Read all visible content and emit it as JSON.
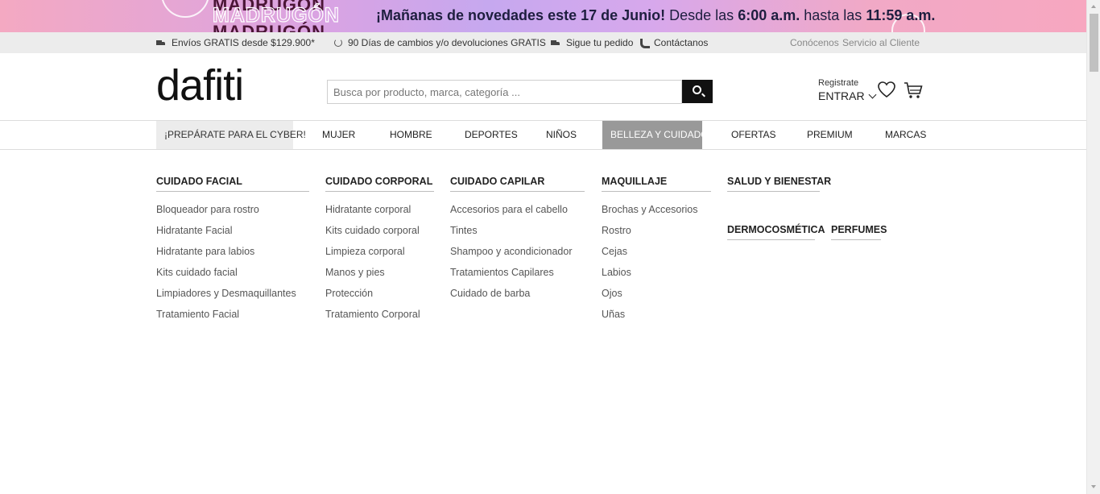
{
  "promo": {
    "brand_word": "MADRUGÓN",
    "headline_bold": "¡Mañanas de novedades este 17 de Junio!",
    "headline_rest_1": "Desde las",
    "time_start": "6:00 a.m.",
    "headline_rest_2": "hasta las",
    "time_end": "11:59 a.m."
  },
  "utility": {
    "shipping": "Envíos GRATIS desde $129.900*",
    "returns": "90 Días de cambios y/o devoluciones GRATIS",
    "tracking": "Sigue tu pedido",
    "contact": "Contáctanos",
    "about": "Conócenos",
    "customer_service": "Servicio al Cliente"
  },
  "header": {
    "logo": "dafiti",
    "search_placeholder": "Busca por producto, marca, categoría ...",
    "register": "Registrate",
    "login": "ENTRAR"
  },
  "nav": {
    "items": [
      "¡PREPÁRATE PARA EL CYBER!",
      "MUJER",
      "HOMBRE",
      "DEPORTES",
      "NIÑOS",
      "BELLEZA Y CUIDADO",
      "OFERTAS",
      "PREMIUM",
      "MARCAS"
    ],
    "active": "BELLEZA Y CUIDADO"
  },
  "menu": {
    "facial": {
      "heading": "CUIDADO FACIAL",
      "items": [
        "Bloqueador para rostro",
        "Hidratante Facial",
        "Hidratante para labios",
        "Kits cuidado facial",
        "Limpiadores y Desmaquillantes",
        "Tratamiento Facial"
      ]
    },
    "corporal": {
      "heading": "CUIDADO CORPORAL",
      "items": [
        "Hidratante corporal",
        "Kits cuidado corporal",
        "Limpieza corporal",
        "Manos y pies",
        "Protección",
        "Tratamiento Corporal"
      ]
    },
    "capilar": {
      "heading": "CUIDADO CAPILAR",
      "items": [
        "Accesorios para el cabello",
        "Tintes",
        "Shampoo y acondicionador",
        "Tratamientos Capilares",
        "Cuidado de barba"
      ]
    },
    "maquillaje": {
      "heading": "MAQUILLAJE",
      "items": [
        "Brochas y Accesorios",
        "Rostro",
        "Cejas",
        "Labios",
        "Ojos",
        "Uñas"
      ]
    },
    "salud": {
      "heading": "SALUD Y BIENESTAR"
    },
    "dermo": {
      "heading": "DERMOCOSMÉTICA"
    },
    "perfumes": {
      "heading": "PERFUMES"
    }
  }
}
